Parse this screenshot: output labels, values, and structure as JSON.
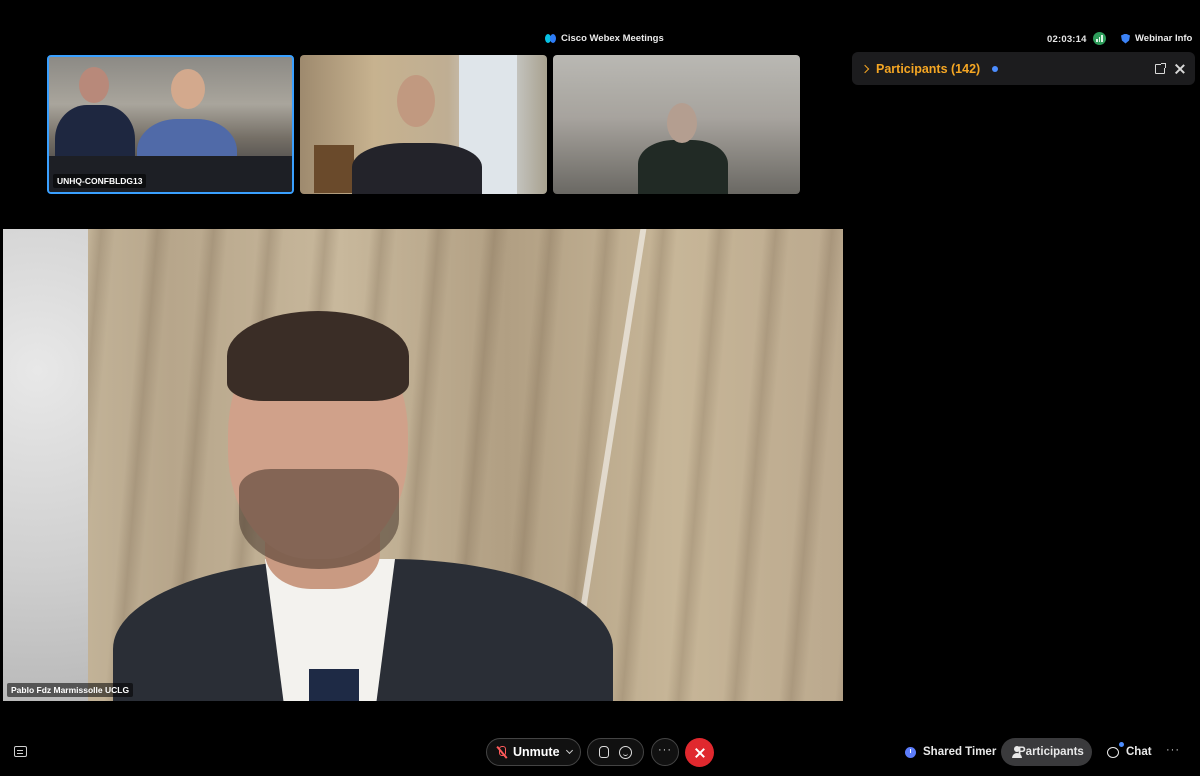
{
  "header": {
    "app_title": "Cisco Webex Meetings",
    "clock": "02:03:14",
    "webinar_info_label": "Webinar Info"
  },
  "thumbnails": [
    {
      "label": "UNHQ-CONFBLDG13",
      "active_speaker": true
    },
    {
      "label": "",
      "active_speaker": false
    },
    {
      "label": "",
      "active_speaker": false
    }
  ],
  "main_video": {
    "name_label": "Pablo Fdz Marmissolle UCLG"
  },
  "participants_panel": {
    "title": "Participants (142)"
  },
  "controls": {
    "unmute_label": "Unmute",
    "more_label": "···",
    "shared_timer_label": "Shared Timer",
    "participants_label": "Participants",
    "chat_label": "Chat",
    "overflow_label": "···"
  },
  "colors": {
    "accent_orange": "#f5a623",
    "leave_red": "#e0282e",
    "active_border_blue": "#3aa0ff",
    "notification_blue": "#4c8dff"
  },
  "icons": [
    "webex-logo-icon",
    "network-status-icon",
    "shield-icon",
    "chevron-right-icon",
    "popout-icon",
    "close-icon",
    "captions-icon",
    "mic-off-icon",
    "chevron-down-icon",
    "raise-hand-icon",
    "emoji-icon",
    "leave-icon",
    "timer-icon",
    "person-icon",
    "chat-icon"
  ]
}
